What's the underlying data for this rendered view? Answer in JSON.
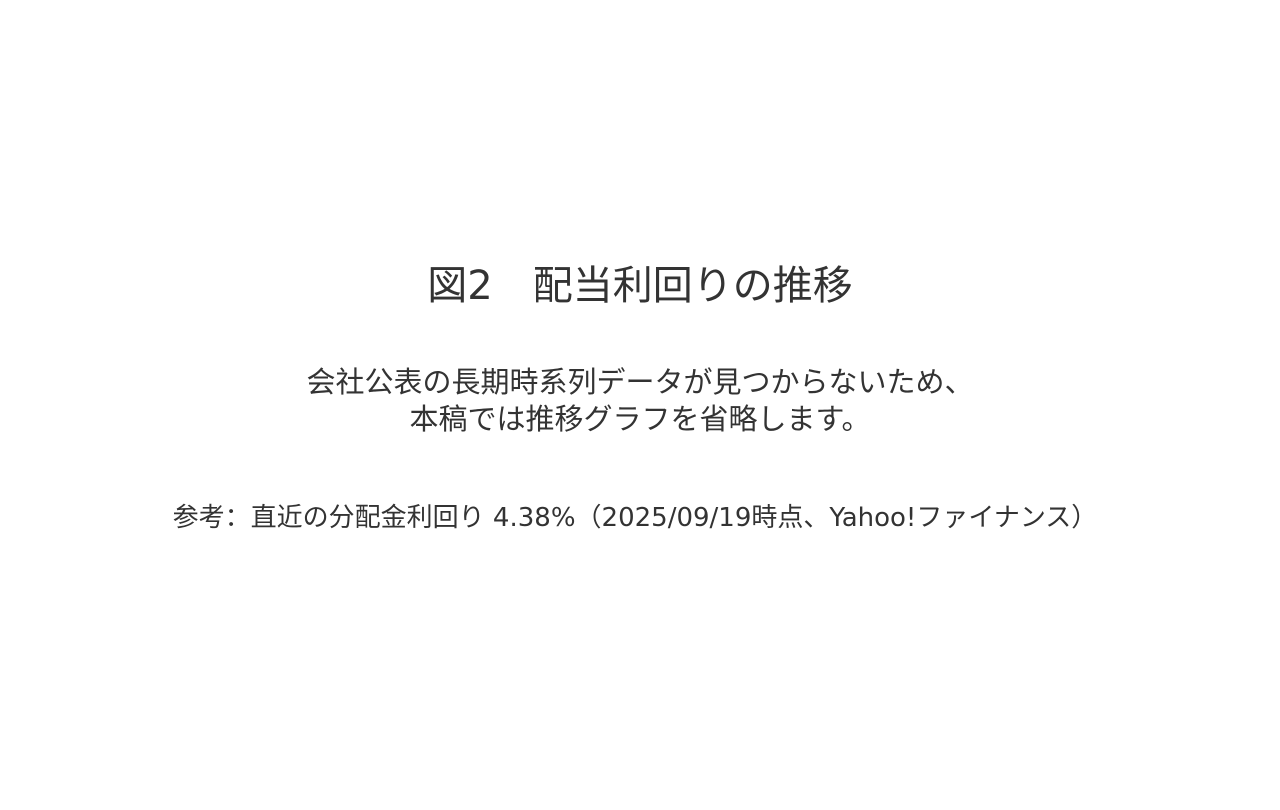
{
  "slide": {
    "title": "図2　配当利回りの推移",
    "message_lines": [
      "会社公表の長期時系列データが見つからないため、",
      "本稿では推移グラフを省略します。"
    ],
    "reference_note": "参考：直近の分配金利回り 4.38%（2025/09/19時点、Yahoo!ファイナンス）"
  }
}
